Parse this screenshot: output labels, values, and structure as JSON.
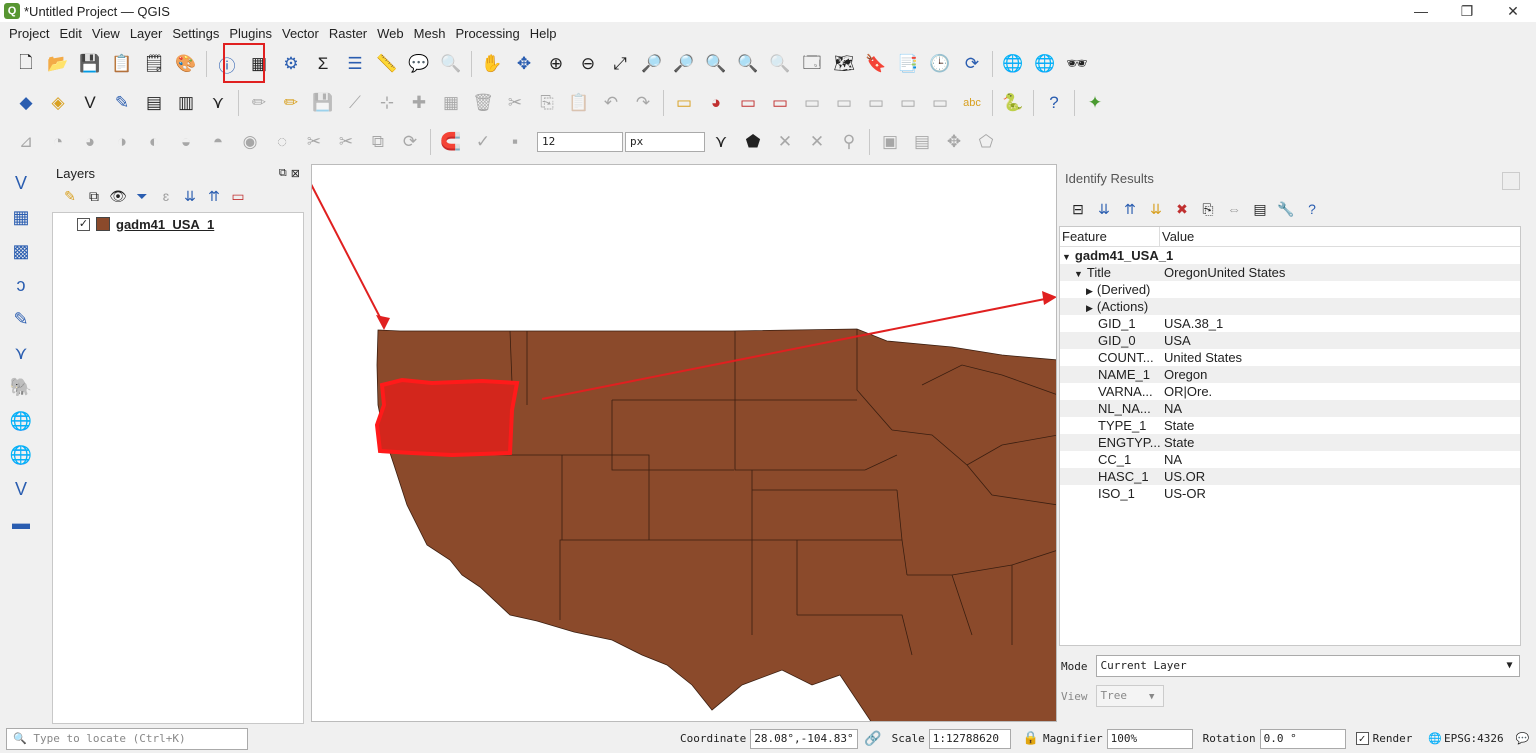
{
  "window": {
    "title": "*Untitled Project — QGIS",
    "min": "—",
    "restore": "❐",
    "close": "✕"
  },
  "menu": [
    "Project",
    "Edit",
    "View",
    "Layer",
    "Settings",
    "Plugins",
    "Vector",
    "Raster",
    "Web",
    "Mesh",
    "Processing",
    "Help"
  ],
  "snapping": {
    "tolerance": "12",
    "unit": "px"
  },
  "layers_panel": {
    "title": "Layers",
    "layer_name": "gadm41_USA_1",
    "layer_color": "#8b4a2b",
    "checked": "✓"
  },
  "identify": {
    "title": "Identify Results",
    "col_feature": "Feature",
    "col_value": "Value",
    "rows": [
      {
        "k": "gadm41_USA_1",
        "v": ""
      },
      {
        "k": "Title",
        "v": "OregonUnited States"
      },
      {
        "k": "(Derived)",
        "v": ""
      },
      {
        "k": "(Actions)",
        "v": ""
      },
      {
        "k": "GID_1",
        "v": "USA.38_1"
      },
      {
        "k": "GID_0",
        "v": "USA"
      },
      {
        "k": "COUNT...",
        "v": "United States"
      },
      {
        "k": "NAME_1",
        "v": "Oregon"
      },
      {
        "k": "VARNA...",
        "v": "OR|Ore."
      },
      {
        "k": "NL_NA...",
        "v": "NA"
      },
      {
        "k": "TYPE_1",
        "v": "State"
      },
      {
        "k": "ENGTYP...",
        "v": "State"
      },
      {
        "k": "CC_1",
        "v": "NA"
      },
      {
        "k": "HASC_1",
        "v": "US.OR"
      },
      {
        "k": "ISO_1",
        "v": "US-OR"
      }
    ],
    "mode_label": "Mode",
    "mode_value": "Current Layer",
    "view_label": "View",
    "view_value": "Tree"
  },
  "status": {
    "locate_placeholder": "Type to locate (Ctrl+K)",
    "coordinate_label": "Coordinate",
    "coordinate_value": "28.08°,-104.83°",
    "scale_label": "Scale",
    "scale_value": "1:12788620",
    "magnifier_label": "Magnifier",
    "magnifier_value": "100%",
    "rotation_label": "Rotation",
    "rotation_value": "0.0 °",
    "render_label": "Render",
    "crs": "EPSG:4326"
  },
  "colors": {
    "state_fill": "#8b4a2b",
    "highlight": "#e41a1a",
    "annotation": "#e02020"
  }
}
